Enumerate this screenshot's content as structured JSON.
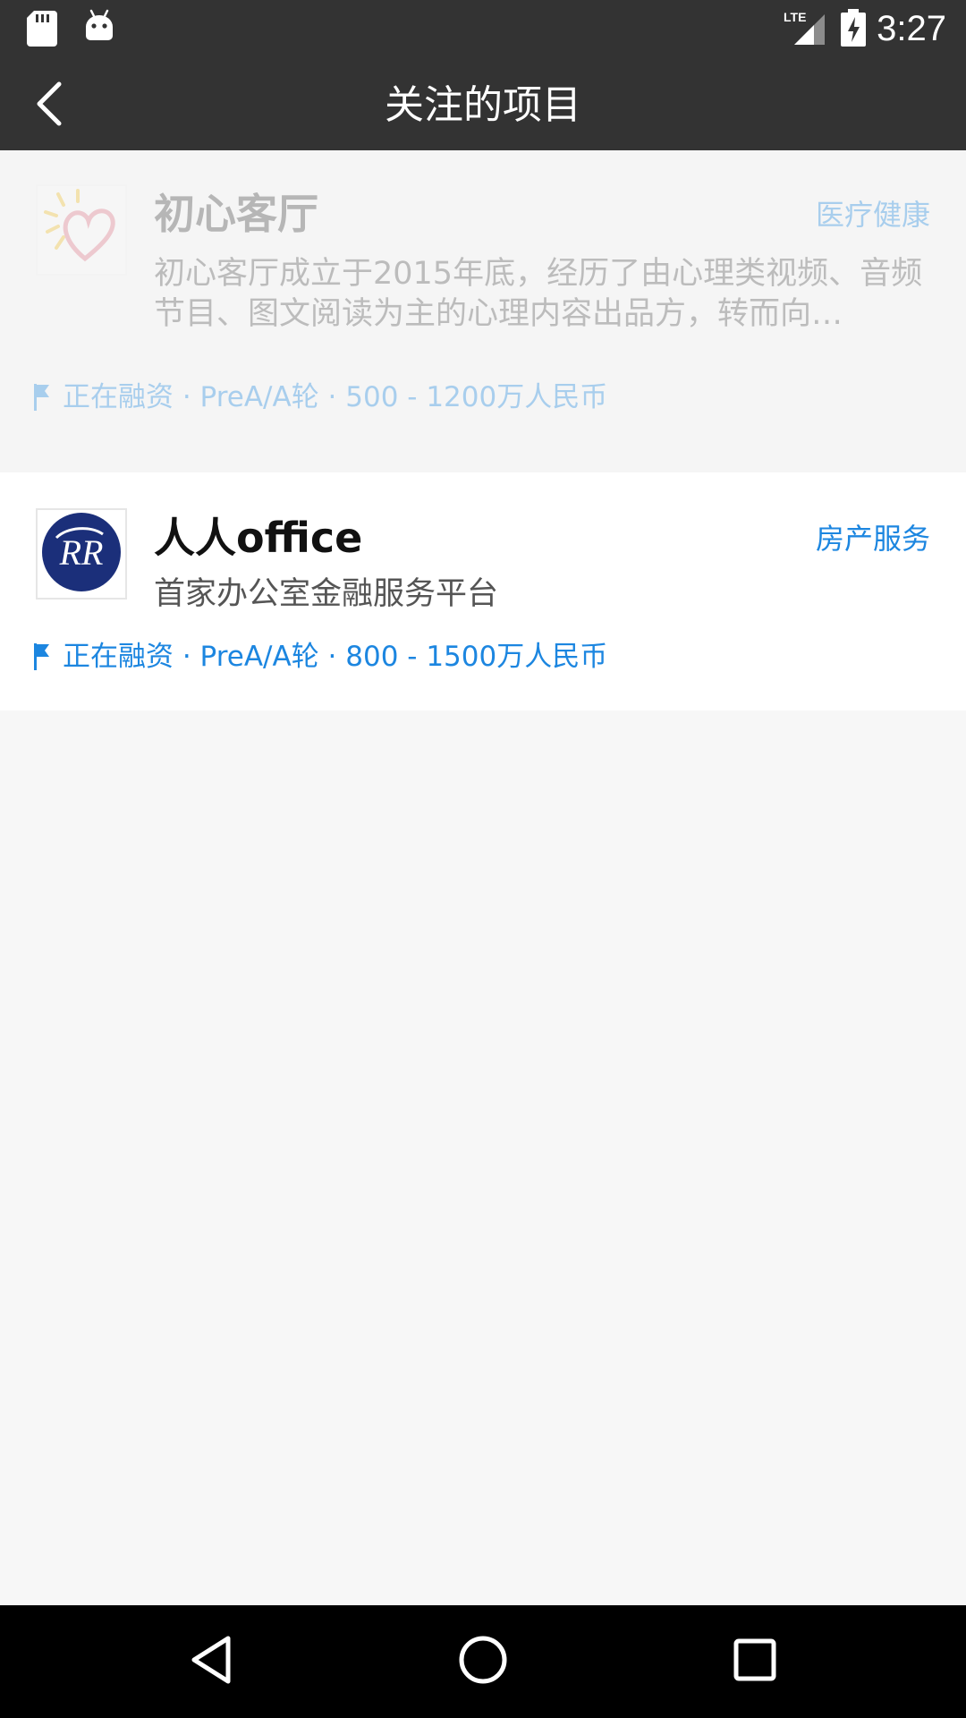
{
  "status_bar": {
    "time": "3:27",
    "network": "LTE",
    "icons": [
      "sd-card-icon",
      "android-icon",
      "lte-signal-icon",
      "battery-charging-icon"
    ]
  },
  "app_bar": {
    "title": "关注的项目",
    "back_icon": "back-arrow-icon"
  },
  "projects": [
    {
      "name": "初心客厅",
      "category": "医疗健康",
      "description": "初心客厅成立于2015年底，经历了由心理类视频、音频节目、图文阅读为主的心理内容出品方，转而向…",
      "funding": "正在融资 · PreA/A轮 · 500 - 1200万人民币",
      "logo_icon": "heart-logo-icon"
    },
    {
      "name": "人人office",
      "category": "房产服务",
      "description": "首家办公室金融服务平台",
      "funding": "正在融资 · PreA/A轮 · 800 - 1500万人民币",
      "logo_icon": "rr-logo-icon"
    }
  ],
  "colors": {
    "bar": "#333333",
    "accent": "#1c86e0",
    "background": "#f7f7f7"
  }
}
